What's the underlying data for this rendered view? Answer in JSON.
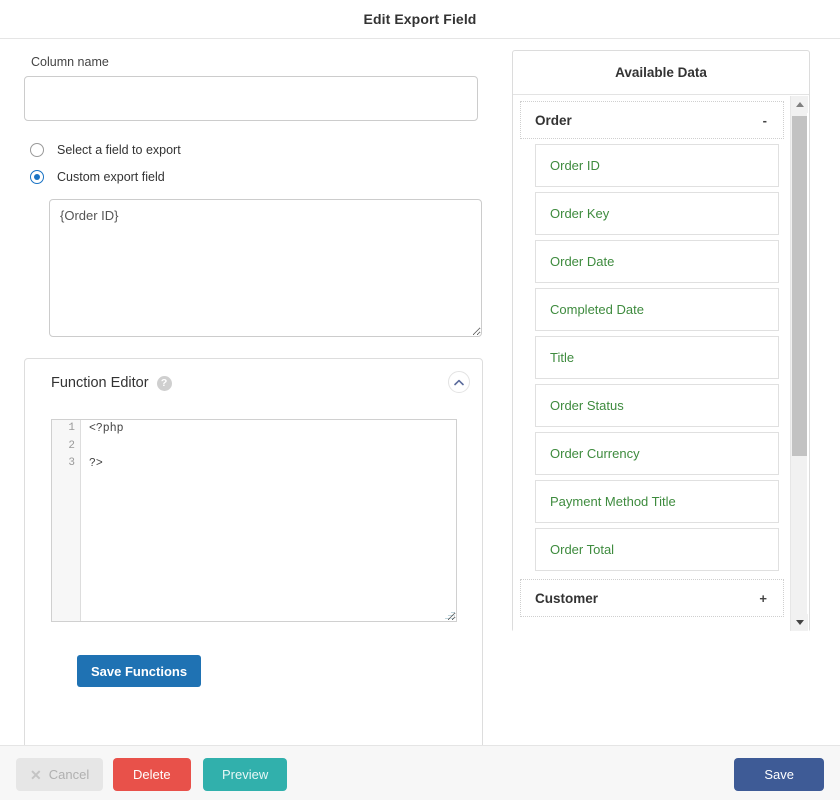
{
  "header": {
    "title": "Edit Export Field"
  },
  "form": {
    "column_name_label": "Column name",
    "column_name_value": "",
    "column_name_placeholder": "",
    "radios": [
      {
        "label": "Select a field to export",
        "checked": false
      },
      {
        "label": "Custom export field",
        "checked": true
      }
    ],
    "custom_export_value": "{Order ID}",
    "custom_export_placeholder": ""
  },
  "function_editor": {
    "title": "Function Editor",
    "help_icon": "question-mark-icon",
    "collapse_icon": "chevron-up-icon",
    "line_numbers": [
      "1",
      "2",
      "3"
    ],
    "code_lines": [
      "<?php",
      "",
      "?>"
    ],
    "save_label": "Save Functions"
  },
  "available_data": {
    "title": "Available Data",
    "groups": [
      {
        "name": "Order",
        "sign": "-",
        "expanded": true,
        "fields": [
          "Order ID",
          "Order Key",
          "Order Date",
          "Completed Date",
          "Title",
          "Order Status",
          "Order Currency",
          "Payment Method Title",
          "Order Total"
        ]
      },
      {
        "name": "Customer",
        "sign": "+",
        "expanded": false,
        "fields": []
      }
    ],
    "scrollbar": {
      "up_icon": "caret-up-icon",
      "down_icon": "caret-down-icon"
    }
  },
  "footer": {
    "cancel_label": "Cancel",
    "cancel_icon": "x-icon",
    "delete_label": "Delete",
    "preview_label": "Preview",
    "save_label": "Save"
  },
  "colors": {
    "save_functions": "#1f72b3",
    "delete": "#e8514a",
    "preview": "#31b0ac",
    "save": "#3e5b96",
    "field_text": "#3e8b3e",
    "radio_accent": "#1a73c4"
  }
}
